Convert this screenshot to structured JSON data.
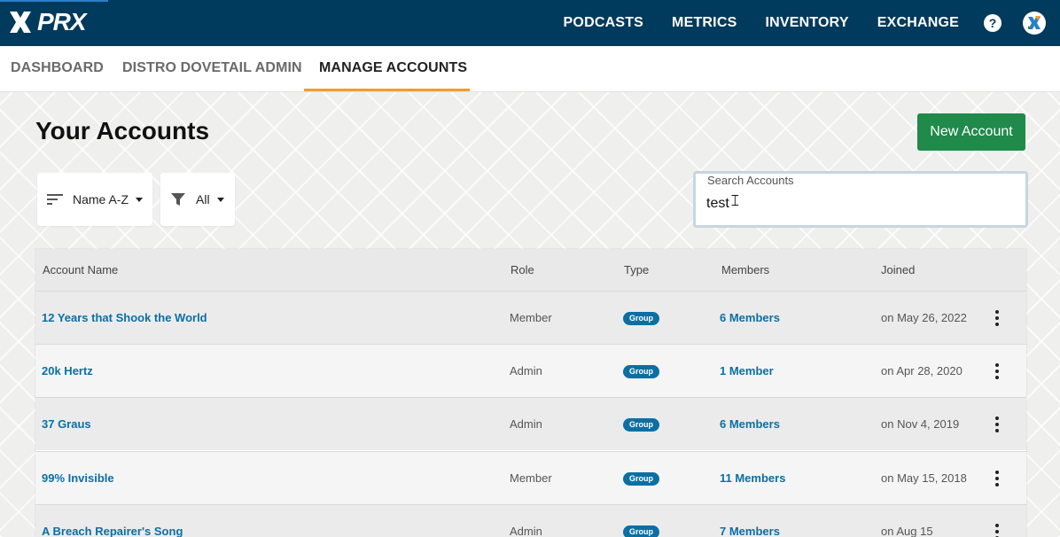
{
  "brand": {
    "logo_text": "PRX"
  },
  "topnav": {
    "items": [
      {
        "label": "PODCASTS"
      },
      {
        "label": "METRICS"
      },
      {
        "label": "INVENTORY"
      },
      {
        "label": "EXCHANGE"
      }
    ],
    "help_symbol": "?"
  },
  "subnav": {
    "items": [
      {
        "label": "DASHBOARD"
      },
      {
        "label": "DISTRO DOVETAIL ADMIN"
      },
      {
        "label": "MANAGE ACCOUNTS",
        "active": true
      }
    ]
  },
  "page": {
    "title": "Your Accounts",
    "new_button": "New Account",
    "sort_label": "Name A-Z",
    "filter_label": "All",
    "search": {
      "label": "Search Accounts",
      "value": "test"
    }
  },
  "table": {
    "headers": [
      "Account Name",
      "Role",
      "Type",
      "Members",
      "Joined"
    ],
    "rows": [
      {
        "name": "12 Years that Shook the World",
        "role": "Member",
        "type": "Group",
        "members": "6 Members",
        "joined": "on May 26, 2022"
      },
      {
        "name": "20k Hertz",
        "role": "Admin",
        "type": "Group",
        "members": "1 Member",
        "joined": "on Apr 28, 2020"
      },
      {
        "name": "37 Graus",
        "role": "Admin",
        "type": "Group",
        "members": "6 Members",
        "joined": "on Nov 4, 2019"
      },
      {
        "name": "99% Invisible",
        "role": "Member",
        "type": "Group",
        "members": "11 Members",
        "joined": "on May 15, 2018"
      },
      {
        "name": "A Breach Repairer's Song",
        "role": "Admin",
        "type": "Group",
        "members": "7 Members",
        "joined": "on Aug 15"
      }
    ]
  },
  "colors": {
    "topbar": "#003a5c",
    "accent_orange": "#f29d2c",
    "primary_green": "#1f8a4a",
    "link_blue": "#0b6fa3"
  }
}
